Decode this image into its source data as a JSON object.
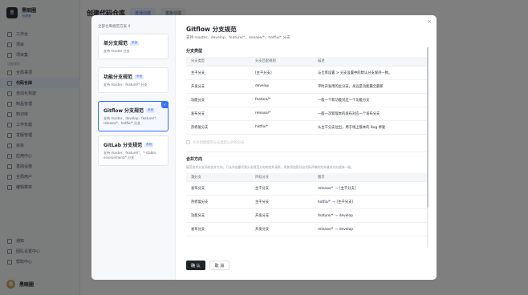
{
  "app": {
    "workspace": "黑眼圈",
    "role": "创建者",
    "page_title": "创建代码仓库",
    "page_tabs": [
      "普通创建",
      "模板创建"
    ],
    "user": "黑眼圈",
    "user_initial": "黑"
  },
  "sidebar": {
    "top_items": [
      "工作台",
      "项目",
      "项目集"
    ],
    "section": "功能模块",
    "items": [
      "全局事项",
      "代码仓库",
      "自动化构建",
      "制品管理",
      "知识库",
      "工作负载",
      "发版管理",
      "目标",
      "应用中心",
      "基础设施",
      "全局用户"
    ],
    "extra": "编辑菜单",
    "bottom_items": [
      "通知",
      "团队设置中心",
      "帮助中心"
    ]
  },
  "modal": {
    "left_title": "全部仓库规范方案 4",
    "schemes": [
      {
        "title": "单分支规范",
        "tag": "系统",
        "desc": "支持 master 分支"
      },
      {
        "title": "功能分支规范",
        "tag": "系统",
        "desc": "支持 master、feature/* 分支"
      },
      {
        "title": "Gitflow 分支规范",
        "tag": "系统",
        "desc": "支持 master、develop、feature/*、release/*、hotfix/* 分支"
      },
      {
        "title": "GitLab 分支规范",
        "tag": "系统",
        "desc": "支持 master、feature/*、*-stable、environment/* 分支"
      }
    ],
    "right_title": "Gitflow 分支规范",
    "right_sub": "支持 master、develop、feature/*、release/*、hotfix/* 分支",
    "branch_section": "分支类型",
    "branch_headers": [
      "分支类型",
      "分支匹配规则",
      "描述"
    ],
    "branch_rows": [
      [
        "主干分支",
        "[主干分支]",
        "与仓库设置 > 分支设置中的默认分支保持一致。"
      ],
      [
        "开发分支",
        "develop",
        "平时开发用的主分支，永远是功能最全最新"
      ],
      [
        "功能分支",
        "feature/*",
        "一般一个新功能对应一个功能分支"
      ],
      [
        "发布分支",
        "release/*",
        "一般一次新版本的发布对应一个发布分支"
      ],
      [
        "热修复分支",
        "hotfix/*",
        "从主干分支拉出，用于线上版本的 Bug 修复"
      ]
    ],
    "allow_option": "允许创建规范分支类型以外的分支",
    "merge_section": "合并方向",
    "merge_desc": "规范合并分支间的合并方向，只允许创建代表分支规范方向的合并请求。将其添加到开启代码评审的合并请求方向保持一致。",
    "merge_headers": [
      "源分支",
      "目标分支",
      "图示"
    ],
    "merge_rows": [
      [
        "发布分支",
        "主干分支",
        "release/*",
        "[主干分支]"
      ],
      [
        "热修复分支",
        "主干分支",
        "hotfix/*",
        "[主干分支]"
      ],
      [
        "功能分支",
        "开发分支",
        "feature/*",
        "develop"
      ],
      [
        "发布分支",
        "开发分支",
        "release/*",
        "develop"
      ]
    ],
    "arrow": "→",
    "ok": "确 认",
    "cancel": "取 消",
    "close": "×",
    "check": "✓"
  }
}
